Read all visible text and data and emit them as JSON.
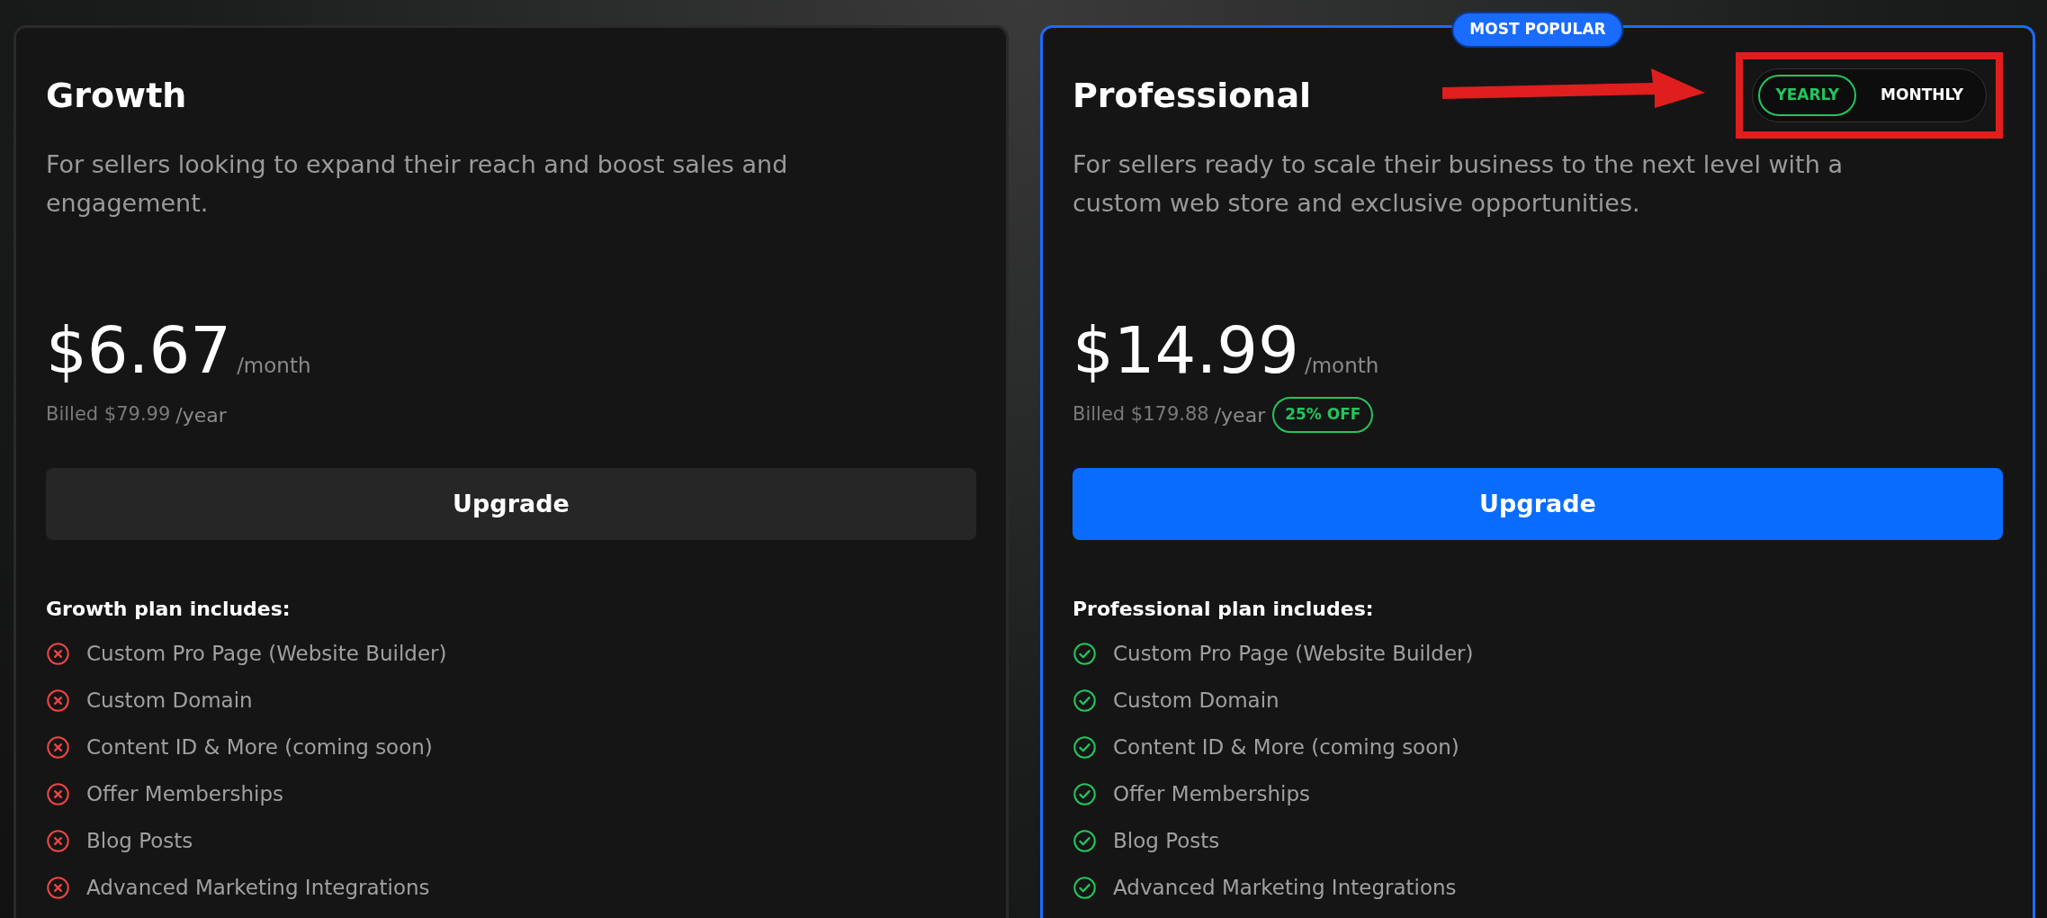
{
  "plans": [
    {
      "name": "Growth",
      "highlighted": false,
      "description": "For sellers looking to expand their reach and boost sales and engagement.",
      "price": "$6.67",
      "period": "/month",
      "billed": "Billed $79.99",
      "billed_period": "/year",
      "button": "Upgrade",
      "includes_title": "Growth plan includes:",
      "features": [
        {
          "label": "Custom Pro Page (Website Builder)",
          "included": false
        },
        {
          "label": "Custom Domain",
          "included": false
        },
        {
          "label": "Content ID & More (coming soon)",
          "included": false
        },
        {
          "label": "Offer Memberships",
          "included": false
        },
        {
          "label": "Blog Posts",
          "included": false
        },
        {
          "label": "Advanced Marketing Integrations",
          "included": false
        }
      ]
    },
    {
      "name": "Professional",
      "highlighted": true,
      "badge": "MOST POPULAR",
      "billing_toggle": [
        {
          "label": "YEARLY",
          "selected": true
        },
        {
          "label": "MONTHLY",
          "selected": false
        }
      ],
      "description": "For sellers ready to scale their business to the next level with a custom web store and exclusive opportunities.",
      "price": "$14.99",
      "period": "/month",
      "billed": "Billed $179.88",
      "billed_period": "/year",
      "discount": "25% OFF",
      "button": "Upgrade",
      "includes_title": "Professional plan includes:",
      "features": [
        {
          "label": "Custom Pro Page (Website Builder)",
          "included": true
        },
        {
          "label": "Custom Domain",
          "included": true
        },
        {
          "label": "Content ID & More (coming soon)",
          "included": true
        },
        {
          "label": "Offer Memberships",
          "included": true
        },
        {
          "label": "Blog Posts",
          "included": true
        },
        {
          "label": "Advanced Marketing Integrations",
          "included": true
        }
      ]
    }
  ]
}
